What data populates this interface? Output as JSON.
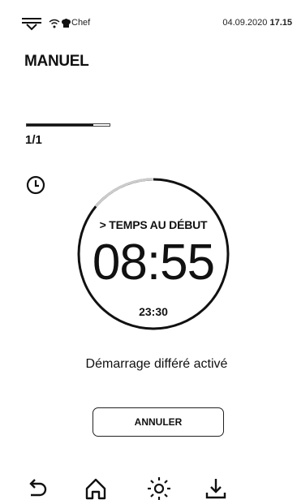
{
  "status_bar": {
    "user": "Chef",
    "date": "04.09.2020",
    "time": "17.15",
    "icons": [
      "menu-dropdown-icon",
      "wifi-icon",
      "chef-hat-icon"
    ]
  },
  "page": {
    "title": "MANUEL"
  },
  "progress": {
    "fraction": 0.8,
    "step_label": "1/1"
  },
  "timer": {
    "icon": "clock-icon",
    "label": "> TEMPS AU DÉBUT",
    "countdown": "08:55",
    "start_time": "23:30",
    "remaining_fraction": 0.14
  },
  "message": "Démarrage différé activé",
  "buttons": {
    "cancel_label": "ANNULER"
  },
  "bottom_nav": {
    "items": [
      "back-icon",
      "home-icon",
      "brightness-icon",
      "download-icon"
    ]
  }
}
